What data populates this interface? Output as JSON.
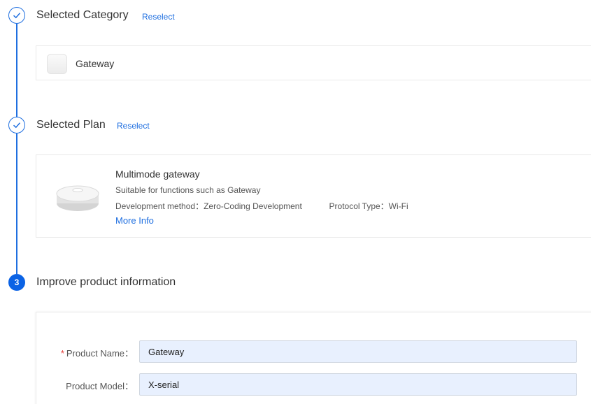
{
  "steps": {
    "category": {
      "title": "Selected Category",
      "reselect": "Reselect",
      "selected": {
        "label": "Gateway",
        "icon": "gateway-square-icon"
      }
    },
    "plan": {
      "title": "Selected Plan",
      "reselect": "Reselect",
      "selected": {
        "name": "Multimode gateway",
        "description": "Suitable for functions such as Gateway",
        "dev_method_label": "Development method：",
        "dev_method_value": "Zero-Coding Development",
        "protocol_label": "Protocol Type：",
        "protocol_value": "Wi-Fi",
        "more_info": "More Info"
      }
    },
    "improve": {
      "number": "3",
      "title": "Improve product information"
    }
  },
  "form": {
    "product_name": {
      "required_mark": "*",
      "label": "Product Name：",
      "value": "Gateway"
    },
    "product_model": {
      "label": "Product Model：",
      "value": "X-serial"
    }
  },
  "colors": {
    "accent": "#1f6fe0",
    "step_active": "#0b63e5",
    "input_bg": "#e8f0fe",
    "required": "#e53935"
  }
}
